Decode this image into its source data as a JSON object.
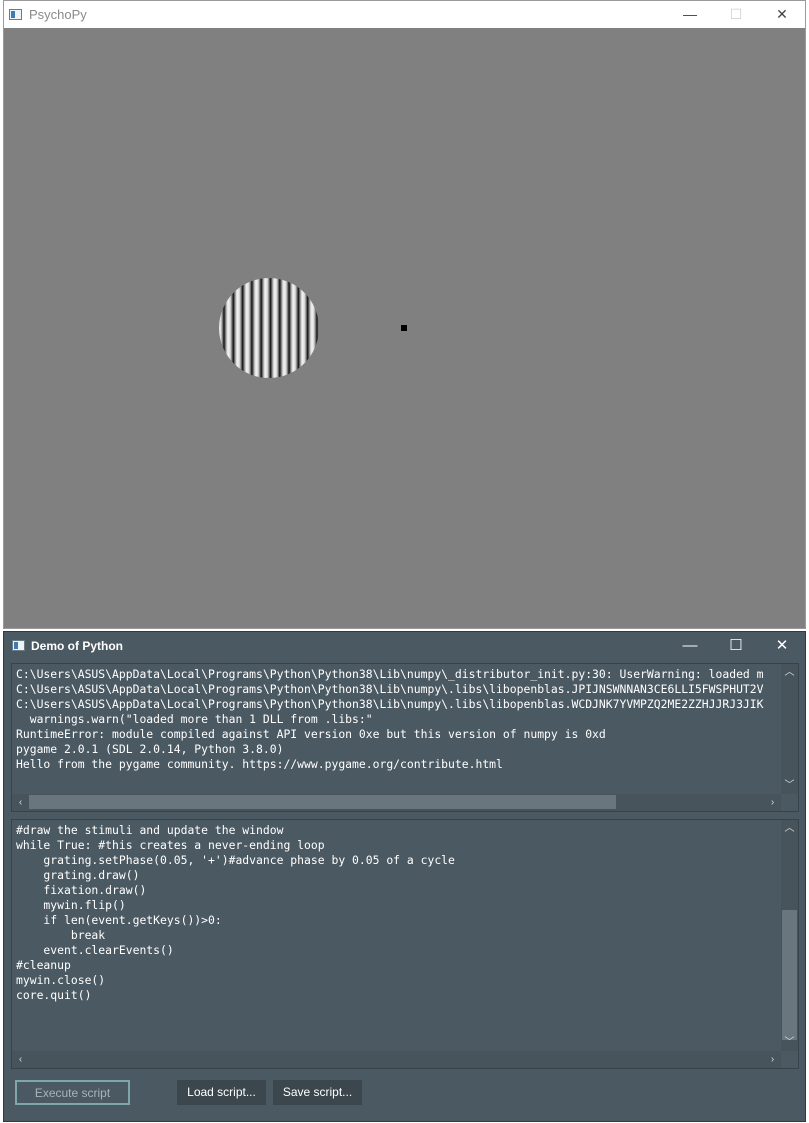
{
  "window1": {
    "title": "PsychoPy",
    "controls": {
      "minimize": "—",
      "maximize": "☐",
      "close": "✕"
    }
  },
  "window2": {
    "title": "Demo of Python",
    "controls": {
      "minimize": "—",
      "maximize": "☐",
      "close": "✕"
    },
    "console_lines": [
      "C:\\Users\\ASUS\\AppData\\Local\\Programs\\Python\\Python38\\Lib\\numpy\\_distributor_init.py:30: UserWarning: loaded m",
      "C:\\Users\\ASUS\\AppData\\Local\\Programs\\Python\\Python38\\Lib\\numpy\\.libs\\libopenblas.JPIJNSWNNAN3CE6LLI5FWSPHUT2V",
      "C:\\Users\\ASUS\\AppData\\Local\\Programs\\Python\\Python38\\Lib\\numpy\\.libs\\libopenblas.WCDJNK7YVMPZQ2ME2ZZHJJRJ3JIK",
      "  warnings.warn(\"loaded more than 1 DLL from .libs:\"",
      "RuntimeError: module compiled against API version 0xe but this version of numpy is 0xd",
      "pygame 2.0.1 (SDL 2.0.14, Python 3.8.0)",
      "Hello from the pygame community. https://www.pygame.org/contribute.html"
    ],
    "editor_lines": [
      "#draw the stimuli and update the window",
      "while True: #this creates a never-ending loop",
      "    grating.setPhase(0.05, '+')#advance phase by 0.05 of a cycle",
      "    grating.draw()",
      "    fixation.draw()",
      "    mywin.flip()",
      "",
      "    if len(event.getKeys())>0:",
      "        break",
      "    event.clearEvents()",
      "",
      "#cleanup",
      "mywin.close()",
      "core.quit()"
    ],
    "buttons": {
      "execute": "Execute script",
      "load": "Load script...",
      "save": "Save script..."
    }
  },
  "icons": {
    "app": "window-app-icon",
    "scroll_left": "‹",
    "scroll_right": "›",
    "scroll_up": "︿",
    "scroll_down": "﹀"
  }
}
